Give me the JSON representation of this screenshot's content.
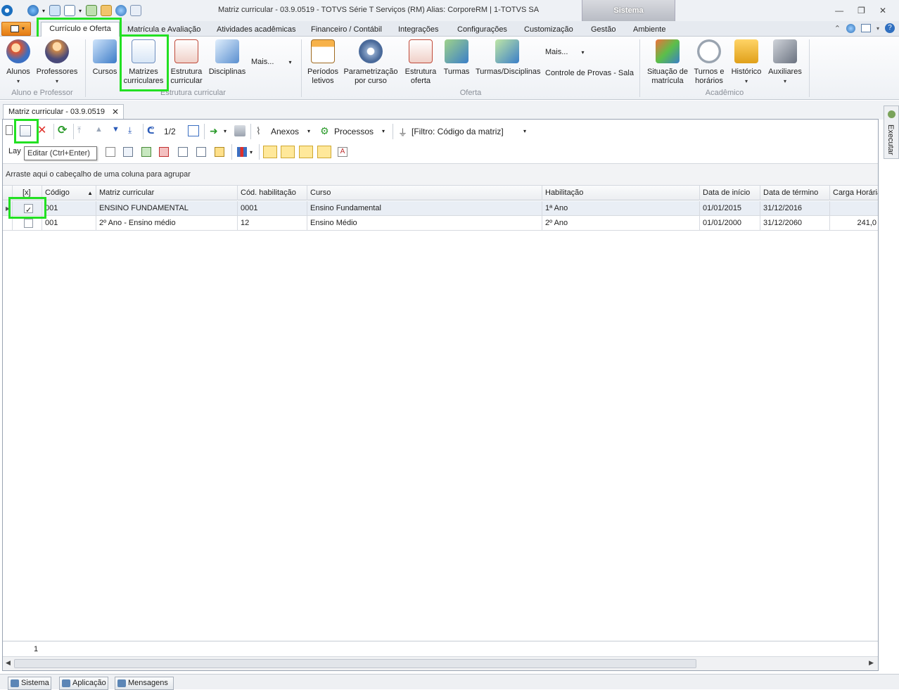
{
  "window": {
    "title": "Matriz curricular - 03.9.0519 - TOTVS Série T Serviços (RM) Alias: CorporeRM | 1-TOTVS SA",
    "context_tab": "Sistema"
  },
  "ribbon_tabs": [
    "Currículo e Oferta",
    "Matrícula e Avaliação",
    "Atividades acadêmicas",
    "Financeiro / Contábil",
    "Integrações",
    "Configurações",
    "Customização",
    "Gestão",
    "Ambiente"
  ],
  "ribbon": {
    "aluno_prof": {
      "label": "Aluno e Professor",
      "alunos": "Alunos",
      "professores": "Professores"
    },
    "estrutura": {
      "label": "Estrutura curricular",
      "cursos": "Cursos",
      "matrizes_l1": "Matrizes",
      "matrizes_l2": "curriculares",
      "estrutura_l1": "Estrutura",
      "estrutura_l2": "curricular",
      "disciplinas": "Disciplinas",
      "mais": "Mais..."
    },
    "oferta": {
      "label": "Oferta",
      "periodos_l1": "Períodos",
      "periodos_l2": "letivos",
      "param_l1": "Parametrização",
      "param_l2": "por curso",
      "estrutura_l1": "Estrutura",
      "estrutura_l2": "oferta",
      "turmas": "Turmas",
      "turmas_disc": "Turmas/Disciplinas",
      "mais": "Mais...",
      "controle": "Controle de Provas - Sala"
    },
    "academico": {
      "label": "Acadêmico",
      "situacao_l1": "Situação de",
      "situacao_l2": "matrícula",
      "turnos_l1": "Turnos e",
      "turnos_l2": "horários",
      "historico": "Histórico",
      "auxiliares": "Auxiliares"
    }
  },
  "doc_tab": {
    "label": "Matriz curricular - 03.9.0519"
  },
  "side_panel": {
    "label": "Executar"
  },
  "toolbar": {
    "page": "1/2",
    "anexos": "Anexos",
    "processos": "Processos",
    "filtro": "[Filtro: Código da matriz]",
    "layout_prefix": "Lay",
    "tooltip": "Editar (Ctrl+Enter)"
  },
  "grid": {
    "group_hint": "Arraste aqui o cabeçalho de uma coluna para agrupar",
    "columns": [
      "[x]",
      "Código",
      "Matriz curricular",
      "Cód. habilitação",
      "Curso",
      "Habilitação",
      "Data de início",
      "Data de término",
      "Carga Horária"
    ],
    "rows": [
      {
        "checked": true,
        "codigo": "001",
        "matriz": "ENSINO FUNDAMENTAL",
        "cod_hab": "0001",
        "curso": "Ensino Fundamental",
        "habilitacao": "1ª Ano",
        "inicio": "01/01/2015",
        "termino": "31/12/2016",
        "carga": ""
      },
      {
        "checked": false,
        "codigo": "001",
        "matriz": "2º Ano - Ensino médio",
        "cod_hab": "12",
        "curso": "Ensino Médio",
        "habilitacao": "2º Ano",
        "inicio": "01/01/2000",
        "termino": "31/12/2060",
        "carga": "241,0"
      }
    ],
    "footer_count": "1"
  },
  "statusbar": [
    "Sistema",
    "Aplicação",
    "Mensagens"
  ],
  "colors": {
    "highlight": "#22e022",
    "accent": "#e47a12"
  }
}
